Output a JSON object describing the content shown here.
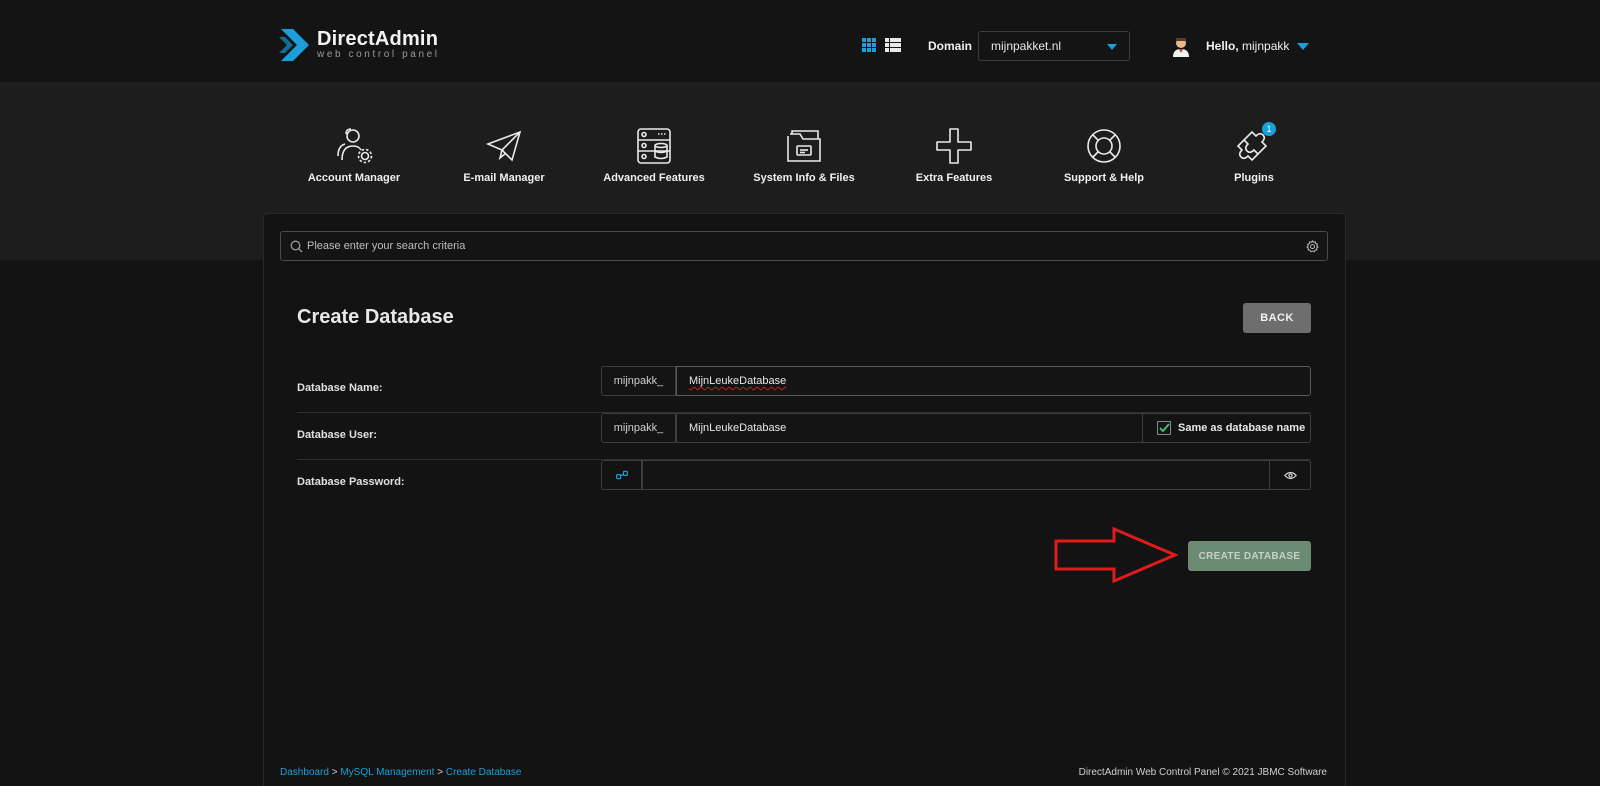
{
  "header": {
    "logo_title": "DirectAdmin",
    "logo_subtitle": "web control panel",
    "domain_label": "Domain",
    "domain_value": "mijnpakket.nl",
    "hello_label": "Hello,",
    "username": "mijnpakk",
    "accent_color": "#1a9fd9"
  },
  "nav": {
    "items": [
      {
        "label": "Account Manager",
        "icon": "users-gear-icon"
      },
      {
        "label": "E-mail Manager",
        "icon": "paper-plane-icon"
      },
      {
        "label": "Advanced Features",
        "icon": "server-icon"
      },
      {
        "label": "System Info & Files",
        "icon": "folder-icon"
      },
      {
        "label": "Extra Features",
        "icon": "plus-icon"
      },
      {
        "label": "Support & Help",
        "icon": "lifebuoy-icon"
      },
      {
        "label": "Plugins",
        "icon": "puzzle-icon",
        "badge": "1"
      }
    ]
  },
  "search": {
    "placeholder": "Please enter your search criteria"
  },
  "page": {
    "title": "Create Database",
    "back_label": "BACK"
  },
  "form": {
    "db_name_label": "Database Name:",
    "db_name_prefix": "mijnpakk_",
    "db_name_value": "MijnLeukeDatabase",
    "db_user_label": "Database User:",
    "db_user_prefix": "mijnpakk_",
    "db_user_value": "MijnLeukeDatabase",
    "same_as_label": "Same as database name",
    "same_as_checked": true,
    "db_password_label": "Database Password:",
    "db_password_value": ""
  },
  "actions": {
    "create_label": "CREATE DATABASE"
  },
  "footer": {
    "crumbs": [
      "Dashboard",
      "MySQL Management",
      "Create Database"
    ],
    "separator": ">",
    "copyright": "DirectAdmin Web Control Panel © 2021 JBMC Software"
  }
}
